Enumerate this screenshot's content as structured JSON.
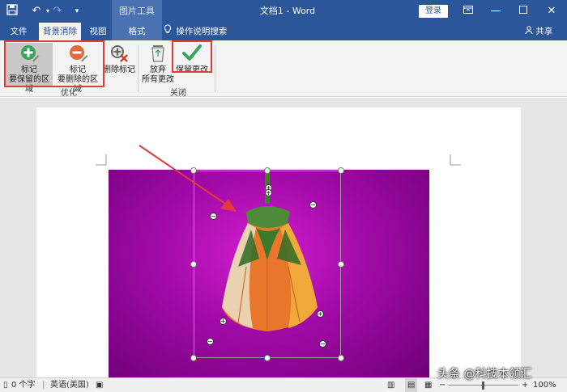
{
  "titlebar": {
    "context_group": "图片工具",
    "doc_title": "文档1 - Word",
    "login": "登录"
  },
  "tabs": {
    "file": "文件",
    "background_removal": "背景消除",
    "view": "视图",
    "format": "格式",
    "tell_me": "操作说明搜索",
    "share": "共享"
  },
  "ribbon": {
    "mark_keep_line1": "标记",
    "mark_keep_line2": "要保留的区域",
    "mark_remove_line1": "标记",
    "mark_remove_line2": "要删除的区域",
    "delete_mark": "删除标记",
    "discard_line1": "放弃",
    "discard_line2": "所有更改",
    "keep_changes": "保留更改",
    "group_refine": "优化",
    "group_close": "关闭"
  },
  "statusbar": {
    "word_count": "0 个字",
    "language": "英语(美国)",
    "zoom": "100%"
  },
  "watermark": "头条 @科技本领汇",
  "colors": {
    "accent": "#2b579a",
    "highlight": "#e23b3b",
    "photo_background": "#b40fb4"
  }
}
